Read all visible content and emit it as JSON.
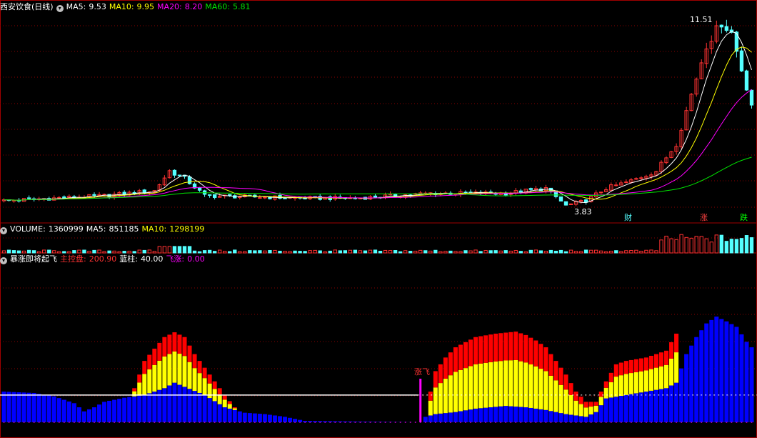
{
  "panels": {
    "price": {
      "title": "西安饮食(日线)",
      "ma5_label": "MA5:",
      "ma5_value": "9.53",
      "ma10_label": "MA10:",
      "ma10_value": "9.95",
      "ma20_label": "MA20:",
      "ma20_value": "8.20",
      "ma60_label": "MA60:",
      "ma60_value": "5.81",
      "high_label": "11.51",
      "low_label": "3.83",
      "event_markers": [
        "财",
        "涨",
        "跌"
      ]
    },
    "volume": {
      "title": "VOLUME:",
      "title_value": "1360999",
      "ma5_label": "MA5:",
      "ma5_value": "851185",
      "ma10_label": "MA10:",
      "ma10_value": "1298199"
    },
    "indicator": {
      "title": "暴涨即将起飞",
      "zhukong_label": "主控盘:",
      "zhukong_value": "200.90",
      "lanzhu_label": "蓝柱:",
      "lanzhu_value": "40.00",
      "feizhang_label": "飞涨:",
      "feizhang_value": "0.00",
      "signal_label": "涨飞"
    }
  },
  "colors": {
    "up": "#ff3232",
    "down": "#54ffff",
    "ma5": "#ffffff",
    "ma10": "#ffff00",
    "ma20": "#ff00ff",
    "ma60": "#00e600",
    "grid": "#8b0000",
    "blue_bar": "#0000ff",
    "yellow_bar": "#ffff00",
    "red_bar": "#ff0000",
    "signal": "#ff00ff"
  },
  "chart_data": [
    {
      "type": "candlestick",
      "title": "西安饮食(日线)",
      "n_bars": 150,
      "price_range": [
        3.5,
        11.8
      ],
      "high": 11.51,
      "low": 3.83,
      "key_points": [
        [
          0,
          4.2
        ],
        [
          20,
          4.4
        ],
        [
          30,
          4.6
        ],
        [
          33,
          5.4
        ],
        [
          36,
          5.1
        ],
        [
          40,
          4.4
        ],
        [
          60,
          4.3
        ],
        [
          70,
          4.3
        ],
        [
          85,
          4.5
        ],
        [
          100,
          4.5
        ],
        [
          108,
          4.7
        ],
        [
          112,
          4.0
        ],
        [
          116,
          4.2
        ],
        [
          120,
          4.7
        ],
        [
          125,
          5.0
        ],
        [
          130,
          5.4
        ],
        [
          134,
          6.5
        ],
        [
          137,
          8.5
        ],
        [
          140,
          10.5
        ],
        [
          143,
          11.4
        ],
        [
          145,
          11.0
        ],
        [
          147,
          9.5
        ],
        [
          149,
          8.1
        ]
      ],
      "series": [
        {
          "name": "MA5",
          "current": 9.53
        },
        {
          "name": "MA10",
          "current": 9.95
        },
        {
          "name": "MA20",
          "current": 8.2
        },
        {
          "name": "MA60",
          "current": 5.81
        }
      ]
    },
    {
      "type": "bar",
      "title": "VOLUME",
      "current": 1360999,
      "series": [
        {
          "name": "MA5",
          "current": 851185
        },
        {
          "name": "MA10",
          "current": 1298199
        }
      ]
    },
    {
      "type": "bar",
      "title": "暴涨即将起飞",
      "ylim": [
        0,
        240
      ],
      "series": [
        {
          "name": "主控盘",
          "current": 200.9
        },
        {
          "name": "蓝柱",
          "current": 40.0
        },
        {
          "name": "飞涨",
          "current": 0.0
        }
      ],
      "reference_line": 40,
      "signal_index": 83,
      "signal_label": "涨飞",
      "blue_keypoints": [
        [
          0,
          45
        ],
        [
          6,
          43
        ],
        [
          10,
          38
        ],
        [
          14,
          28
        ],
        [
          16,
          16
        ],
        [
          18,
          22
        ],
        [
          20,
          30
        ],
        [
          24,
          36
        ],
        [
          28,
          40
        ],
        [
          32,
          50
        ],
        [
          34,
          58
        ],
        [
          36,
          52
        ],
        [
          40,
          40
        ],
        [
          44,
          22
        ],
        [
          48,
          14
        ],
        [
          52,
          12
        ],
        [
          56,
          8
        ],
        [
          60,
          2
        ],
        [
          83,
          0
        ],
        [
          84,
          8
        ],
        [
          86,
          12
        ],
        [
          90,
          15
        ],
        [
          94,
          20
        ],
        [
          100,
          24
        ],
        [
          104,
          22
        ],
        [
          108,
          18
        ],
        [
          112,
          12
        ],
        [
          116,
          8
        ],
        [
          118,
          15
        ],
        [
          120,
          35
        ],
        [
          124,
          40
        ],
        [
          128,
          45
        ],
        [
          132,
          50
        ],
        [
          134,
          58
        ],
        [
          136,
          100
        ],
        [
          138,
          125
        ],
        [
          140,
          145
        ],
        [
          142,
          155
        ],
        [
          144,
          148
        ],
        [
          146,
          140
        ],
        [
          148,
          118
        ],
        [
          149,
          110
        ]
      ],
      "total_keypoints": [
        [
          0,
          0
        ],
        [
          24,
          0
        ],
        [
          26,
          50
        ],
        [
          28,
          90
        ],
        [
          30,
          108
        ],
        [
          32,
          125
        ],
        [
          34,
          132
        ],
        [
          36,
          125
        ],
        [
          38,
          100
        ],
        [
          40,
          80
        ],
        [
          42,
          60
        ],
        [
          44,
          40
        ],
        [
          46,
          22
        ],
        [
          48,
          0
        ],
        [
          84,
          0
        ],
        [
          85,
          45
        ],
        [
          86,
          75
        ],
        [
          88,
          95
        ],
        [
          90,
          110
        ],
        [
          94,
          125
        ],
        [
          98,
          130
        ],
        [
          102,
          133
        ],
        [
          104,
          128
        ],
        [
          106,
          120
        ],
        [
          108,
          110
        ],
        [
          110,
          90
        ],
        [
          112,
          70
        ],
        [
          114,
          45
        ],
        [
          116,
          30
        ],
        [
          118,
          30
        ],
        [
          120,
          60
        ],
        [
          122,
          85
        ],
        [
          124,
          90
        ],
        [
          128,
          95
        ],
        [
          132,
          105
        ],
        [
          134,
          130
        ],
        [
          135,
          0
        ]
      ],
      "split_ratio": 0.62
    }
  ]
}
